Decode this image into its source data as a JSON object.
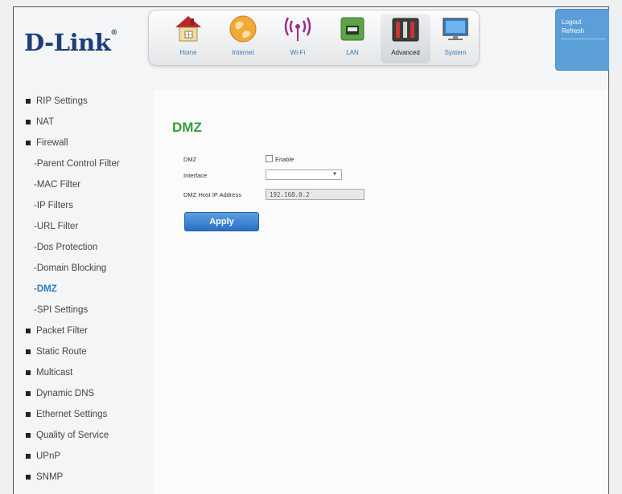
{
  "brand": {
    "logo_text": "D-Link",
    "mark": "®"
  },
  "nav": [
    {
      "label": "Home",
      "icon": "home-icon"
    },
    {
      "label": "Internet",
      "icon": "globe-icon"
    },
    {
      "label": "Wi-Fi",
      "icon": "wifi-icon"
    },
    {
      "label": "LAN",
      "icon": "lan-port-icon"
    },
    {
      "label": "Advanced",
      "icon": "advanced-tools-icon"
    },
    {
      "label": "System",
      "icon": "monitor-icon"
    }
  ],
  "account": {
    "logout": "Logout",
    "refresh": "Refresh"
  },
  "sidebar": [
    {
      "label": "RIP Settings"
    },
    {
      "label": "NAT"
    },
    {
      "label": "Firewall"
    },
    {
      "label": "-Parent Control Filter"
    },
    {
      "label": "-MAC Filter"
    },
    {
      "label": "-IP Filters"
    },
    {
      "label": "-URL Filter"
    },
    {
      "label": "-Dos Protection"
    },
    {
      "label": "-Domain Blocking"
    },
    {
      "label": "-DMZ"
    },
    {
      "label": "-SPI Settings"
    },
    {
      "label": "Packet Filter"
    },
    {
      "label": "Static Route"
    },
    {
      "label": "Multicast"
    },
    {
      "label": "Dynamic DNS"
    },
    {
      "label": "Ethernet Settings"
    },
    {
      "label": "Quality of Service"
    },
    {
      "label": "UPnP"
    },
    {
      "label": "SNMP"
    }
  ],
  "main": {
    "title": "DMZ",
    "dmz_label": "DMZ",
    "enable_label": "Enable",
    "enable_checked": false,
    "interface_label": "Interface",
    "interface_value": "",
    "host_ip_label": "DMZ Host IP Address",
    "host_ip_value": "192.168.0.2",
    "apply_label": "Apply"
  },
  "colors": {
    "accent": "#2b7bc3",
    "title_green": "#3a9b3a",
    "brand_navy": "#1d3d7c",
    "logout_panel": "#5b9fd8"
  }
}
